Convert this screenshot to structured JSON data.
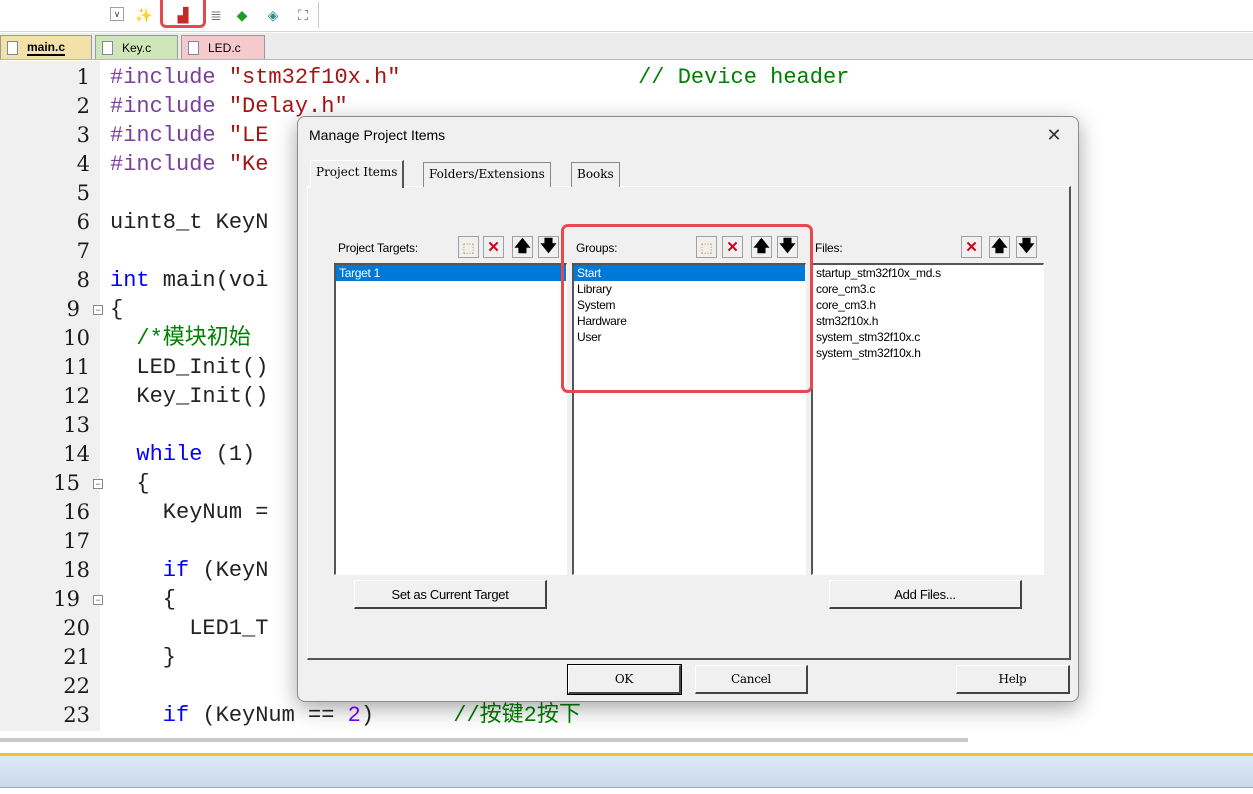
{
  "toolbar": {
    "icons": [
      {
        "name": "dropdown-arrow-icon",
        "glyph": "∨"
      },
      {
        "name": "magic-wand-icon",
        "glyph": "✨"
      },
      {
        "name": "manage-project-items-icon",
        "glyph": "▟"
      },
      {
        "name": "stack-icon",
        "glyph": "≣"
      },
      {
        "name": "green-diamond-icon",
        "glyph": "◆"
      },
      {
        "name": "teal-diamond-icon",
        "glyph": "◈"
      },
      {
        "name": "books-icon",
        "glyph": "⛶"
      }
    ],
    "highlight_color": "#e5484d"
  },
  "tabs": [
    {
      "label": "main.c",
      "color": "#f3e2a8",
      "active": true
    },
    {
      "label": "Key.c",
      "color": "#cfe6b8"
    },
    {
      "label": "LED.c",
      "color": "#f6c9cc"
    }
  ],
  "editor": {
    "line_numbers": [
      "1",
      "2",
      "3",
      "4",
      "5",
      "6",
      "7",
      "8",
      "9",
      "10",
      "11",
      "12",
      "13",
      "14",
      "15",
      "16",
      "17",
      "18",
      "19",
      "20",
      "21",
      "22",
      "23"
    ],
    "lines": [
      {
        "pre": "#include ",
        "str": "\"stm32f10x.h\"",
        "pad": "                  ",
        "cmt": "// Device header"
      },
      {
        "pre": "#include ",
        "str": "\"Delay.h\""
      },
      {
        "pre": "#include ",
        "str": "\"LE"
      },
      {
        "pre": "#include ",
        "str": "\"Ke"
      },
      {
        "text": ""
      },
      {
        "text": "uint8_t KeyN"
      },
      {
        "text": ""
      },
      {
        "kw": "int",
        "text": " main(voi"
      },
      {
        "text": "{"
      },
      {
        "cmt": "  /*模块初始"
      },
      {
        "text": "  LED_Init()"
      },
      {
        "text": "  Key_Init()"
      },
      {
        "text": ""
      },
      {
        "kw": "  while",
        "text": " (1)"
      },
      {
        "text": "  {"
      },
      {
        "text": "    KeyNum ="
      },
      {
        "text": ""
      },
      {
        "kw": "    if",
        "text": " (KeyN"
      },
      {
        "text": "    {"
      },
      {
        "text": "      LED1_T"
      },
      {
        "text": "    }"
      },
      {
        "text": ""
      },
      {
        "kw": "    if",
        "text": " (KeyNum == ",
        "num": "2",
        "text2": ")      ",
        "cmt": "//按键2按下"
      }
    ]
  },
  "dialog": {
    "title": "Manage Project Items",
    "close_glyph": "✕",
    "tabs": [
      "Project Items",
      "Folders/Extensions",
      "Books"
    ],
    "targets": {
      "label": "Project Targets:",
      "items": [
        "Target 1"
      ],
      "selected": "Target 1"
    },
    "groups": {
      "label": "Groups:",
      "items": [
        "Start",
        "Library",
        "System",
        "Hardware",
        "User"
      ],
      "selected": "Start"
    },
    "files": {
      "label": "Files:",
      "items": [
        "startup_stm32f10x_md.s",
        "core_cm3.c",
        "core_cm3.h",
        "stm32f10x.h",
        "system_stm32f10x.c",
        "system_stm32f10x.h"
      ]
    },
    "list_buttons": {
      "new": "⬚",
      "delete": "✕",
      "up": "🡅",
      "down": "🡇"
    },
    "buttons": {
      "set_current_target": "Set as Current Target",
      "add_files": "Add Files...",
      "ok": "OK",
      "cancel": "Cancel",
      "help": "Help"
    },
    "selection_color": "#0078d7"
  }
}
